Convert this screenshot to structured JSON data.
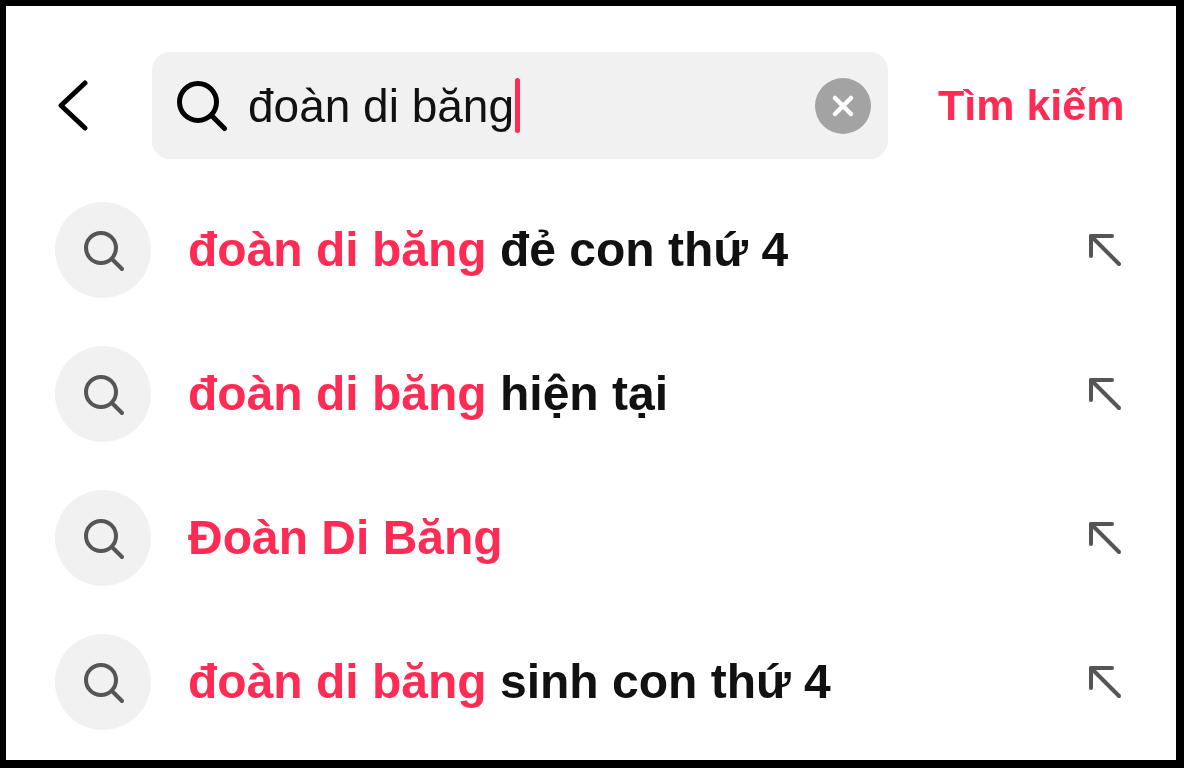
{
  "header": {
    "search_field": {
      "value": "đoàn di băng",
      "focused": true
    },
    "search_button": "Tìm kiếm"
  },
  "suggestions": [
    {
      "highlight": "đoàn di băng",
      "text": "đẻ con thứ 4"
    },
    {
      "highlight": "đoàn di băng",
      "text": "hiện tại"
    },
    {
      "highlight": "Đoàn Di Băng"
    },
    {
      "highlight": "đoàn di băng",
      "text": "sinh con thứ 4"
    }
  ]
}
